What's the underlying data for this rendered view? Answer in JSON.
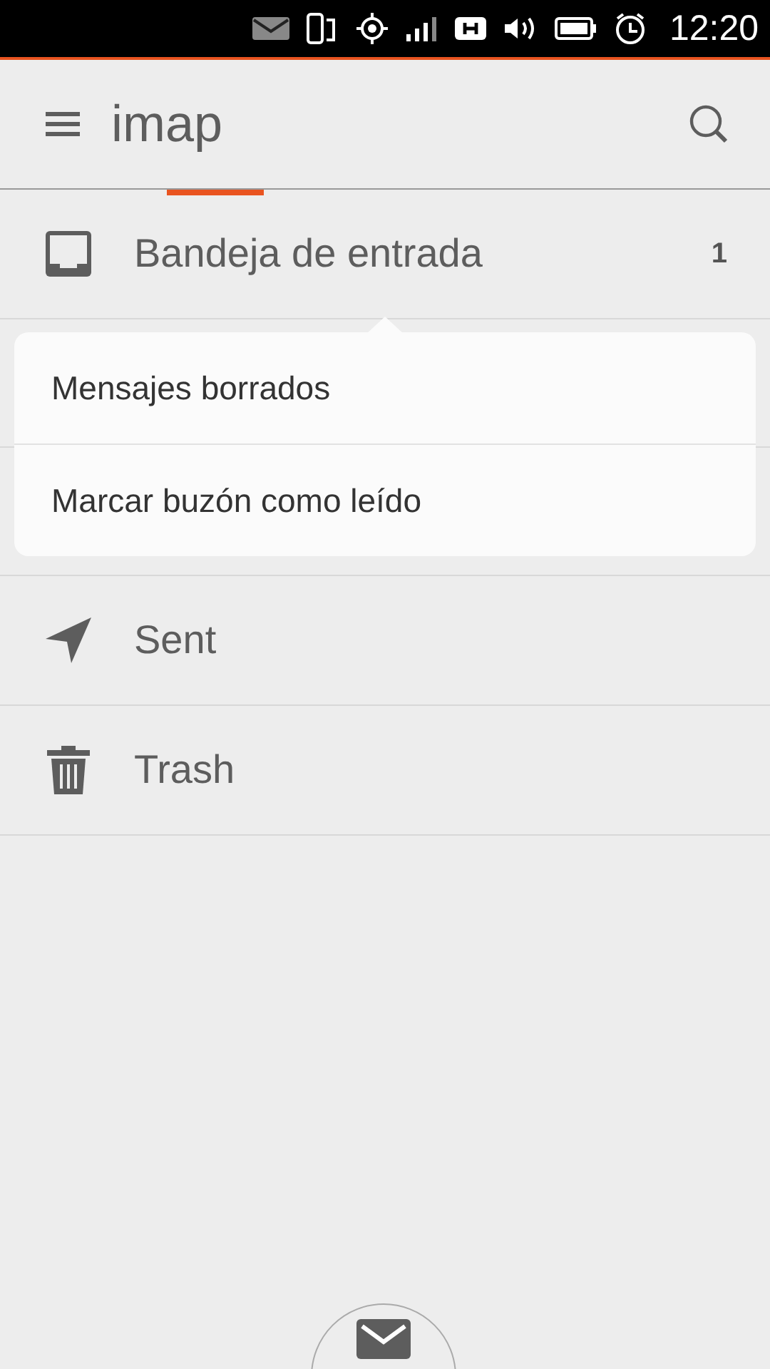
{
  "status_bar": {
    "time": "12:20"
  },
  "header": {
    "title": "imap"
  },
  "folders": [
    {
      "kind": "inbox",
      "name": "Bandeja de entrada",
      "count": "1"
    },
    {
      "kind": "sent",
      "name": "Sent"
    },
    {
      "kind": "trash",
      "name": "Trash"
    }
  ],
  "popup_menu": {
    "items": [
      "Mensajes borrados",
      "Marcar buzón como leído"
    ]
  }
}
